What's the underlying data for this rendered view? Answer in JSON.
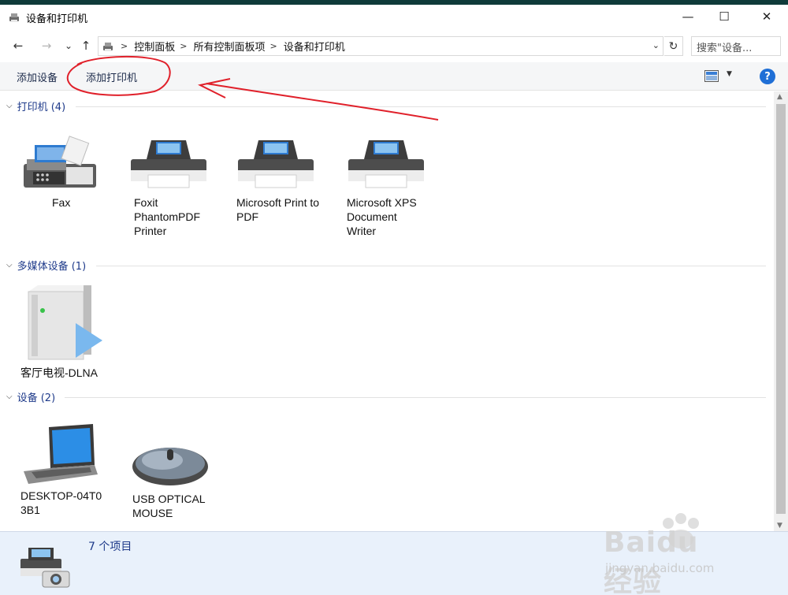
{
  "window": {
    "title": "设备和打印机",
    "minimize_glyph": "—",
    "maximize_glyph": "☐",
    "close_glyph": "✕"
  },
  "address": {
    "back_glyph": "←",
    "forward_glyph": "→",
    "recent_glyph": "⌄",
    "up_glyph": "↑",
    "sep_glyph": ">",
    "crumbs": [
      "控制面板",
      "所有控制面板项",
      "设备和打印机"
    ],
    "dropdown_glyph": "⌄",
    "refresh_glyph": "↻",
    "search_placeholder": "搜索\"设备...",
    "search_icon": "search-icon"
  },
  "toolbar": {
    "add_device": "添加设备",
    "add_printer": "添加打印机",
    "view_dropdown_glyph": "▼",
    "help_label": "?"
  },
  "groups": [
    {
      "header": "打印机 (4)",
      "items": [
        {
          "label": "Fax",
          "icon": "fax-icon"
        },
        {
          "label": "Foxit PhantomPDF Printer",
          "icon": "printer-icon"
        },
        {
          "label": "Microsoft Print to PDF",
          "icon": "printer-icon"
        },
        {
          "label": "Microsoft XPS Document Writer",
          "icon": "printer-icon"
        }
      ]
    },
    {
      "header": "多媒体设备 (1)",
      "items": [
        {
          "label": "客厅电视-DLNA",
          "icon": "media-server-icon"
        }
      ]
    },
    {
      "header": "设备 (2)",
      "items": [
        {
          "label": "DESKTOP-04T0 3B1",
          "icon": "laptop-icon"
        },
        {
          "label": "USB OPTICAL MOUSE",
          "icon": "mouse-icon"
        }
      ]
    }
  ],
  "status": {
    "count_text": "7 个项目"
  },
  "scroll": {
    "up_glyph": "▲",
    "down_glyph": "▼"
  },
  "watermark": {
    "brand": "Baidu经验",
    "url": "jingyan.baidu.com"
  },
  "colors": {
    "accent": "#1e3a8a",
    "annotation": "#e0202a",
    "help": "#1f6fd6",
    "status_bg": "#e9f1fb"
  }
}
